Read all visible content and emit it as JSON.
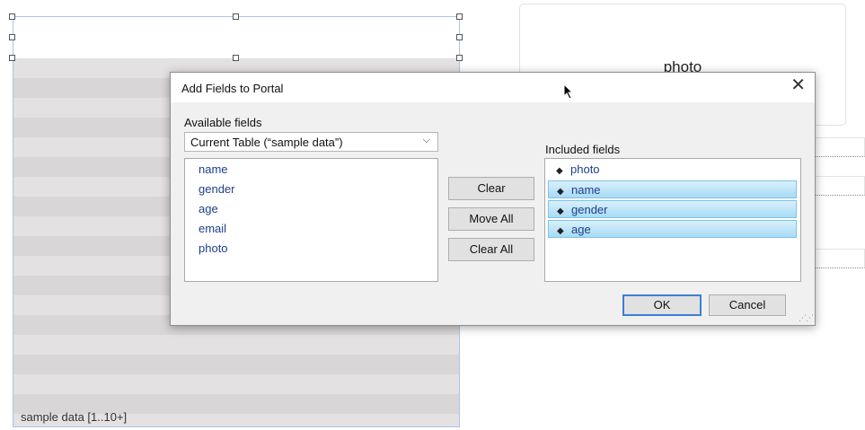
{
  "layout": {
    "portal_footer": "sample data [1..10+]",
    "photo_label": "photo"
  },
  "dialog": {
    "title": "Add Fields to Portal",
    "available_label": "Available fields",
    "table_select": "Current Table (“sample data”)",
    "available_fields": [
      "name",
      "gender",
      "age",
      "email",
      "photo"
    ],
    "included_label": "Included fields",
    "included_fields": [
      {
        "label": "photo",
        "selected": false
      },
      {
        "label": "name",
        "selected": true
      },
      {
        "label": "gender",
        "selected": true
      },
      {
        "label": "age",
        "selected": true
      }
    ],
    "buttons": {
      "clear": "Clear",
      "move_all": "Move All",
      "clear_all": "Clear All",
      "ok": "OK",
      "cancel": "Cancel"
    },
    "icons": {
      "close": "close-icon",
      "chevron": "chevron-down-icon",
      "grip": "move-handle-icon"
    }
  }
}
